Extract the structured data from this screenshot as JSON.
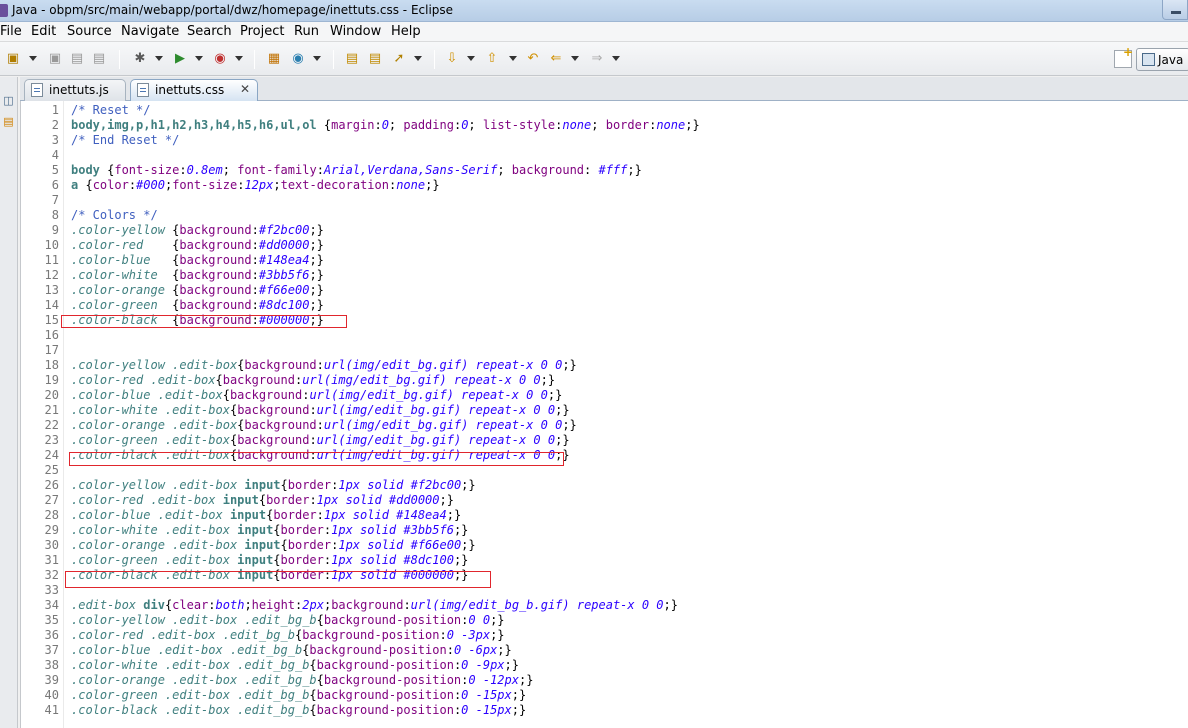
{
  "window": {
    "title": "Java - obpm/src/main/webapp/portal/dwz/homepage/inettuts.css - Eclipse"
  },
  "menu": [
    "File",
    "Edit",
    "Source",
    "Navigate",
    "Search",
    "Project",
    "Run",
    "Window",
    "Help"
  ],
  "perspective": {
    "label": "Java"
  },
  "tabs": [
    {
      "label": "inettuts.js",
      "active": false
    },
    {
      "label": "inettuts.css",
      "active": true
    }
  ],
  "editor": {
    "lines": [
      {
        "n": "1",
        "tokens": [
          [
            "c-comment",
            "/* Reset */"
          ]
        ]
      },
      {
        "n": "2",
        "tokens": [
          [
            "c-tag",
            "body,img,p,h1,h2,h3,h4,h5,h6,ul,ol"
          ],
          [
            "c-punc",
            " {"
          ],
          [
            "c-prop",
            "margin"
          ],
          [
            "c-punc",
            ":"
          ],
          [
            "c-val",
            "0"
          ],
          [
            "c-punc",
            "; "
          ],
          [
            "c-prop",
            "padding"
          ],
          [
            "c-punc",
            ":"
          ],
          [
            "c-val",
            "0"
          ],
          [
            "c-punc",
            "; "
          ],
          [
            "c-prop",
            "list-style"
          ],
          [
            "c-punc",
            ":"
          ],
          [
            "c-val",
            "none"
          ],
          [
            "c-punc",
            "; "
          ],
          [
            "c-prop",
            "border"
          ],
          [
            "c-punc",
            ":"
          ],
          [
            "c-val",
            "none"
          ],
          [
            "c-punc",
            ";}"
          ]
        ]
      },
      {
        "n": "3",
        "tokens": [
          [
            "c-comment",
            "/* End Reset */"
          ]
        ]
      },
      {
        "n": "4",
        "tokens": []
      },
      {
        "n": "5",
        "tokens": [
          [
            "c-tag",
            "body"
          ],
          [
            "c-punc",
            " {"
          ],
          [
            "c-prop",
            "font-size"
          ],
          [
            "c-punc",
            ":"
          ],
          [
            "c-val",
            "0.8em"
          ],
          [
            "c-punc",
            "; "
          ],
          [
            "c-prop",
            "font-family"
          ],
          [
            "c-punc",
            ":"
          ],
          [
            "c-val",
            "Arial,Verdana,Sans-Serif"
          ],
          [
            "c-punc",
            "; "
          ],
          [
            "c-prop",
            "background"
          ],
          [
            "c-punc",
            ": "
          ],
          [
            "c-val",
            "#fff"
          ],
          [
            "c-punc",
            ";}"
          ]
        ]
      },
      {
        "n": "6",
        "tokens": [
          [
            "c-tag",
            "a"
          ],
          [
            "c-punc",
            " {"
          ],
          [
            "c-prop",
            "color"
          ],
          [
            "c-punc",
            ":"
          ],
          [
            "c-val",
            "#000"
          ],
          [
            "c-punc",
            ";"
          ],
          [
            "c-prop",
            "font-size"
          ],
          [
            "c-punc",
            ":"
          ],
          [
            "c-val",
            "12px"
          ],
          [
            "c-punc",
            ";"
          ],
          [
            "c-prop",
            "text-decoration"
          ],
          [
            "c-punc",
            ":"
          ],
          [
            "c-val",
            "none"
          ],
          [
            "c-punc",
            ";}"
          ]
        ]
      },
      {
        "n": "7",
        "tokens": []
      },
      {
        "n": "8",
        "tokens": [
          [
            "c-comment",
            "/* Colors */"
          ]
        ]
      },
      {
        "n": "9",
        "tokens": [
          [
            "c-sel",
            ".color-yellow"
          ],
          [
            "c-punc",
            " {"
          ],
          [
            "c-prop",
            "background"
          ],
          [
            "c-punc",
            ":"
          ],
          [
            "c-val",
            "#f2bc00"
          ],
          [
            "c-punc",
            ";}"
          ]
        ]
      },
      {
        "n": "10",
        "tokens": [
          [
            "c-sel",
            ".color-red"
          ],
          [
            "c-punc",
            "    {"
          ],
          [
            "c-prop",
            "background"
          ],
          [
            "c-punc",
            ":"
          ],
          [
            "c-val",
            "#dd0000"
          ],
          [
            "c-punc",
            ";}"
          ]
        ]
      },
      {
        "n": "11",
        "tokens": [
          [
            "c-sel",
            ".color-blue"
          ],
          [
            "c-punc",
            "   {"
          ],
          [
            "c-prop",
            "background"
          ],
          [
            "c-punc",
            ":"
          ],
          [
            "c-val",
            "#148ea4"
          ],
          [
            "c-punc",
            ";}"
          ]
        ]
      },
      {
        "n": "12",
        "tokens": [
          [
            "c-sel",
            ".color-white"
          ],
          [
            "c-punc",
            "  {"
          ],
          [
            "c-prop",
            "background"
          ],
          [
            "c-punc",
            ":"
          ],
          [
            "c-val",
            "#3bb5f6"
          ],
          [
            "c-punc",
            ";}"
          ]
        ]
      },
      {
        "n": "13",
        "tokens": [
          [
            "c-sel",
            ".color-orange"
          ],
          [
            "c-punc",
            " {"
          ],
          [
            "c-prop",
            "background"
          ],
          [
            "c-punc",
            ":"
          ],
          [
            "c-val",
            "#f66e00"
          ],
          [
            "c-punc",
            ";}"
          ]
        ]
      },
      {
        "n": "14",
        "tokens": [
          [
            "c-sel",
            ".color-green"
          ],
          [
            "c-punc",
            "  {"
          ],
          [
            "c-prop",
            "background"
          ],
          [
            "c-punc",
            ":"
          ],
          [
            "c-val",
            "#8dc100"
          ],
          [
            "c-punc",
            ";}"
          ]
        ]
      },
      {
        "n": "15",
        "tokens": [
          [
            "c-sel",
            ".color-black"
          ],
          [
            "c-punc",
            "  {"
          ],
          [
            "c-prop",
            "background"
          ],
          [
            "c-punc",
            ":"
          ],
          [
            "c-val",
            "#000000"
          ],
          [
            "c-punc",
            ";}"
          ]
        ]
      },
      {
        "n": "16",
        "tokens": []
      },
      {
        "n": "17",
        "tokens": []
      },
      {
        "n": "18",
        "tokens": [
          [
            "c-sel",
            ".color-yellow .edit-box"
          ],
          [
            "c-punc",
            "{"
          ],
          [
            "c-prop",
            "background"
          ],
          [
            "c-punc",
            ":"
          ],
          [
            "c-val",
            "url(img/edit_bg.gif) repeat-x 0 0"
          ],
          [
            "c-punc",
            ";}"
          ]
        ]
      },
      {
        "n": "19",
        "tokens": [
          [
            "c-sel",
            ".color-red .edit-box"
          ],
          [
            "c-punc",
            "{"
          ],
          [
            "c-prop",
            "background"
          ],
          [
            "c-punc",
            ":"
          ],
          [
            "c-val",
            "url(img/edit_bg.gif) repeat-x 0 0"
          ],
          [
            "c-punc",
            ";}"
          ]
        ]
      },
      {
        "n": "20",
        "tokens": [
          [
            "c-sel",
            ".color-blue .edit-box"
          ],
          [
            "c-punc",
            "{"
          ],
          [
            "c-prop",
            "background"
          ],
          [
            "c-punc",
            ":"
          ],
          [
            "c-val",
            "url(img/edit_bg.gif) repeat-x 0 0"
          ],
          [
            "c-punc",
            ";}"
          ]
        ]
      },
      {
        "n": "21",
        "tokens": [
          [
            "c-sel",
            ".color-white .edit-box"
          ],
          [
            "c-punc",
            "{"
          ],
          [
            "c-prop",
            "background"
          ],
          [
            "c-punc",
            ":"
          ],
          [
            "c-val",
            "url(img/edit_bg.gif) repeat-x 0 0"
          ],
          [
            "c-punc",
            ";}"
          ]
        ]
      },
      {
        "n": "22",
        "tokens": [
          [
            "c-sel",
            ".color-orange .edit-box"
          ],
          [
            "c-punc",
            "{"
          ],
          [
            "c-prop",
            "background"
          ],
          [
            "c-punc",
            ":"
          ],
          [
            "c-val",
            "url(img/edit_bg.gif) repeat-x 0 0"
          ],
          [
            "c-punc",
            ";}"
          ]
        ]
      },
      {
        "n": "23",
        "tokens": [
          [
            "c-sel",
            ".color-green .edit-box"
          ],
          [
            "c-punc",
            "{"
          ],
          [
            "c-prop",
            "background"
          ],
          [
            "c-punc",
            ":"
          ],
          [
            "c-val",
            "url(img/edit_bg.gif) repeat-x 0 0"
          ],
          [
            "c-punc",
            ";}"
          ]
        ]
      },
      {
        "n": "24",
        "tokens": [
          [
            "c-sel",
            ".color-black .edit-box"
          ],
          [
            "c-punc",
            "{"
          ],
          [
            "c-prop",
            "background"
          ],
          [
            "c-punc",
            ":"
          ],
          [
            "c-val",
            "url(img/edit_bg.gif) repeat-x 0 0"
          ],
          [
            "c-punc",
            ";}"
          ]
        ]
      },
      {
        "n": "25",
        "tokens": []
      },
      {
        "n": "26",
        "tokens": [
          [
            "c-sel",
            ".color-yellow .edit-box "
          ],
          [
            "c-tag",
            "input"
          ],
          [
            "c-punc",
            "{"
          ],
          [
            "c-prop",
            "border"
          ],
          [
            "c-punc",
            ":"
          ],
          [
            "c-val",
            "1px solid #f2bc00"
          ],
          [
            "c-punc",
            ";}"
          ]
        ]
      },
      {
        "n": "27",
        "tokens": [
          [
            "c-sel",
            ".color-red .edit-box "
          ],
          [
            "c-tag",
            "input"
          ],
          [
            "c-punc",
            "{"
          ],
          [
            "c-prop",
            "border"
          ],
          [
            "c-punc",
            ":"
          ],
          [
            "c-val",
            "1px solid #dd0000"
          ],
          [
            "c-punc",
            ";}"
          ]
        ]
      },
      {
        "n": "28",
        "tokens": [
          [
            "c-sel",
            ".color-blue .edit-box "
          ],
          [
            "c-tag",
            "input"
          ],
          [
            "c-punc",
            "{"
          ],
          [
            "c-prop",
            "border"
          ],
          [
            "c-punc",
            ":"
          ],
          [
            "c-val",
            "1px solid #148ea4"
          ],
          [
            "c-punc",
            ";}"
          ]
        ]
      },
      {
        "n": "29",
        "tokens": [
          [
            "c-sel",
            ".color-white .edit-box "
          ],
          [
            "c-tag",
            "input"
          ],
          [
            "c-punc",
            "{"
          ],
          [
            "c-prop",
            "border"
          ],
          [
            "c-punc",
            ":"
          ],
          [
            "c-val",
            "1px solid #3bb5f6"
          ],
          [
            "c-punc",
            ";}"
          ]
        ]
      },
      {
        "n": "30",
        "tokens": [
          [
            "c-sel",
            ".color-orange .edit-box "
          ],
          [
            "c-tag",
            "input"
          ],
          [
            "c-punc",
            "{"
          ],
          [
            "c-prop",
            "border"
          ],
          [
            "c-punc",
            ":"
          ],
          [
            "c-val",
            "1px solid #f66e00"
          ],
          [
            "c-punc",
            ";}"
          ]
        ]
      },
      {
        "n": "31",
        "tokens": [
          [
            "c-sel",
            ".color-green .edit-box "
          ],
          [
            "c-tag",
            "input"
          ],
          [
            "c-punc",
            "{"
          ],
          [
            "c-prop",
            "border"
          ],
          [
            "c-punc",
            ":"
          ],
          [
            "c-val",
            "1px solid #8dc100"
          ],
          [
            "c-punc",
            ";}"
          ]
        ]
      },
      {
        "n": "32",
        "tokens": [
          [
            "c-sel",
            ".color-black .edit-box "
          ],
          [
            "c-tag",
            "input"
          ],
          [
            "c-punc",
            "{"
          ],
          [
            "c-prop",
            "border"
          ],
          [
            "c-punc",
            ":"
          ],
          [
            "c-val",
            "1px solid #000000"
          ],
          [
            "c-punc",
            ";}"
          ]
        ]
      },
      {
        "n": "33",
        "tokens": []
      },
      {
        "n": "34",
        "tokens": [
          [
            "c-sel",
            ".edit-box "
          ],
          [
            "c-tag",
            "div"
          ],
          [
            "c-punc",
            "{"
          ],
          [
            "c-prop",
            "clear"
          ],
          [
            "c-punc",
            ":"
          ],
          [
            "c-val",
            "both"
          ],
          [
            "c-punc",
            ";"
          ],
          [
            "c-prop",
            "height"
          ],
          [
            "c-punc",
            ":"
          ],
          [
            "c-val",
            "2px"
          ],
          [
            "c-punc",
            ";"
          ],
          [
            "c-prop",
            "background"
          ],
          [
            "c-punc",
            ":"
          ],
          [
            "c-val",
            "url(img/edit_bg_b.gif) repeat-x 0 0"
          ],
          [
            "c-punc",
            ";}"
          ]
        ]
      },
      {
        "n": "35",
        "tokens": [
          [
            "c-sel",
            ".color-yellow .edit-box .edit_bg_b"
          ],
          [
            "c-punc",
            "{"
          ],
          [
            "c-prop",
            "background-position"
          ],
          [
            "c-punc",
            ":"
          ],
          [
            "c-val",
            "0 0"
          ],
          [
            "c-punc",
            ";}"
          ]
        ]
      },
      {
        "n": "36",
        "tokens": [
          [
            "c-sel",
            ".color-red .edit-box .edit_bg_b"
          ],
          [
            "c-punc",
            "{"
          ],
          [
            "c-prop",
            "background-position"
          ],
          [
            "c-punc",
            ":"
          ],
          [
            "c-val",
            "0 -3px"
          ],
          [
            "c-punc",
            ";}"
          ]
        ]
      },
      {
        "n": "37",
        "tokens": [
          [
            "c-sel",
            ".color-blue .edit-box .edit_bg_b"
          ],
          [
            "c-punc",
            "{"
          ],
          [
            "c-prop",
            "background-position"
          ],
          [
            "c-punc",
            ":"
          ],
          [
            "c-val",
            "0 -6px"
          ],
          [
            "c-punc",
            ";}"
          ]
        ]
      },
      {
        "n": "38",
        "tokens": [
          [
            "c-sel",
            ".color-white .edit-box .edit_bg_b"
          ],
          [
            "c-punc",
            "{"
          ],
          [
            "c-prop",
            "background-position"
          ],
          [
            "c-punc",
            ":"
          ],
          [
            "c-val",
            "0 -9px"
          ],
          [
            "c-punc",
            ";}"
          ]
        ]
      },
      {
        "n": "39",
        "tokens": [
          [
            "c-sel",
            ".color-orange .edit-box .edit_bg_b"
          ],
          [
            "c-punc",
            "{"
          ],
          [
            "c-prop",
            "background-position"
          ],
          [
            "c-punc",
            ":"
          ],
          [
            "c-val",
            "0 -12px"
          ],
          [
            "c-punc",
            ";}"
          ]
        ]
      },
      {
        "n": "40",
        "tokens": [
          [
            "c-sel",
            ".color-green .edit-box .edit_bg_b"
          ],
          [
            "c-punc",
            "{"
          ],
          [
            "c-prop",
            "background-position"
          ],
          [
            "c-punc",
            ":"
          ],
          [
            "c-val",
            "0 -15px"
          ],
          [
            "c-punc",
            ";}"
          ]
        ]
      },
      {
        "n": "41",
        "tokens": [
          [
            "c-sel",
            ".color-black .edit-box .edit_bg_b"
          ],
          [
            "c-punc",
            "{"
          ],
          [
            "c-prop",
            "background-position"
          ],
          [
            "c-punc",
            ":"
          ],
          [
            "c-val",
            "0 -15px"
          ],
          [
            "c-punc",
            ";}"
          ]
        ]
      }
    ]
  }
}
